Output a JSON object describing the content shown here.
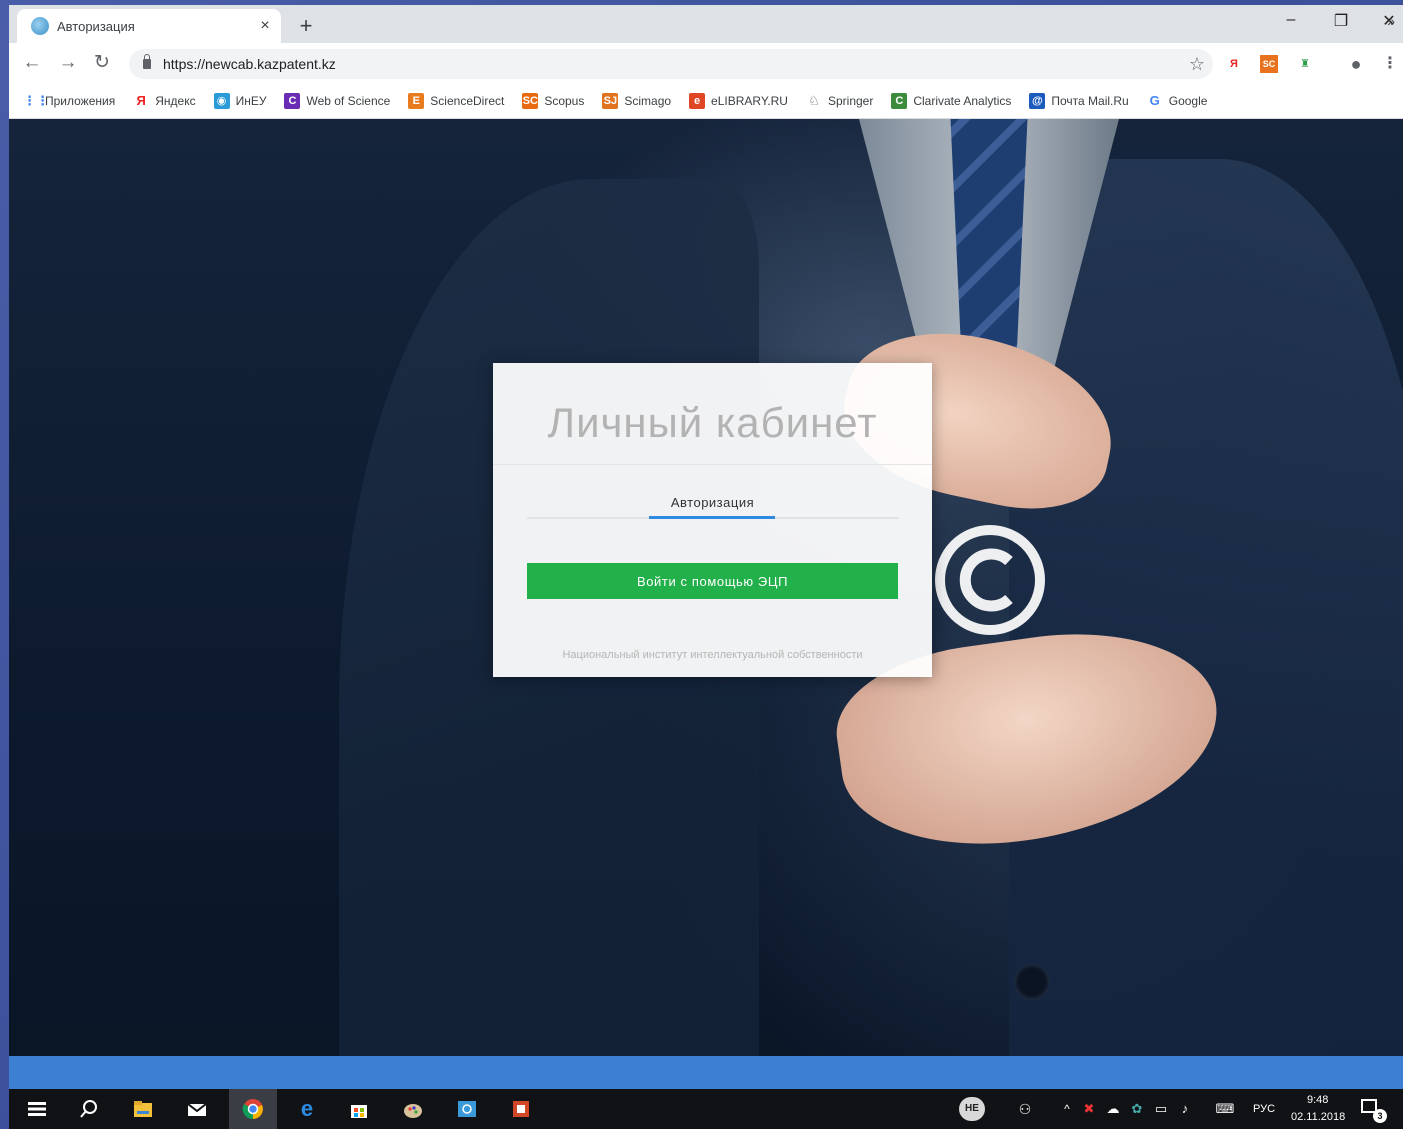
{
  "browser": {
    "tab": {
      "title": "Авторизация",
      "close": "×"
    },
    "new_tab": "+",
    "window_controls": {
      "minimize": "–",
      "restore": "❐",
      "close": "✕"
    },
    "nav": {
      "back": "←",
      "forward": "→",
      "reload": "↻"
    },
    "url": "https://newcab.kazpatent.kz",
    "star": "☆",
    "extensions": {
      "yandex": "Я",
      "sc": "SC",
      "green": "♜",
      "profile": "●",
      "menu": "⋮"
    }
  },
  "bookmarks": [
    {
      "label": "Приложения",
      "icon": "apps-icon",
      "glyph": "⋮⋮",
      "color": "#4285f4"
    },
    {
      "label": "Яндекс",
      "icon": "yandex-icon",
      "glyph": "Я",
      "color": "#e22"
    },
    {
      "label": "ИнЕУ",
      "icon": "globe-icon",
      "glyph": "◉",
      "color": "#2a9bd6"
    },
    {
      "label": "Web of Science",
      "icon": "clarivate-icon",
      "glyph": "C",
      "color": "#6a2bb5"
    },
    {
      "label": "ScienceDirect",
      "icon": "elsevier-icon",
      "glyph": "E",
      "color": "#e87b1d"
    },
    {
      "label": "Scopus",
      "icon": "scopus-icon",
      "glyph": "SC",
      "color": "#e86a10"
    },
    {
      "label": "Scimago",
      "icon": "scimago-icon",
      "glyph": "SJ",
      "color": "#e07320"
    },
    {
      "label": "eLIBRARY.RU",
      "icon": "elibrary-icon",
      "glyph": "e",
      "color": "#e04524"
    },
    {
      "label": "Springer",
      "icon": "springer-icon",
      "glyph": "♘",
      "color": "#555"
    },
    {
      "label": "Clarivate Analytics",
      "icon": "clarivate-icon",
      "glyph": "C",
      "color": "#3d8b3d"
    },
    {
      "label": "Почта Mail.Ru",
      "icon": "mail-icon",
      "glyph": "@",
      "color": "#1a5bbd"
    },
    {
      "label": "Google",
      "icon": "google-icon",
      "glyph": "G",
      "color": "#4285f4"
    }
  ],
  "bookmarks_more": "»",
  "login": {
    "heading": "Личный кабинет",
    "tab_label": "Авторизация",
    "button_label": "Войти с помощью ЭЦП",
    "footer": "Национальный институт интеллектуальной собственности"
  },
  "taskbar": {
    "tray": {
      "lang_badge": "НЕ",
      "lang": "РУС",
      "time": "9:48",
      "date": "02.11.2018",
      "notifications": "3"
    }
  },
  "colors": {
    "accent_green": "#22b04b",
    "tab_active": "#2d8ae0",
    "status_bar": "#3d7fd1"
  }
}
